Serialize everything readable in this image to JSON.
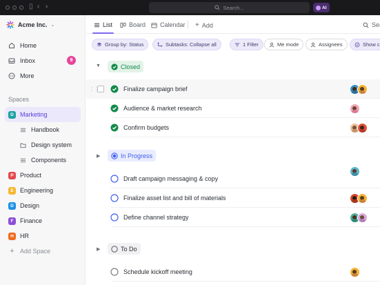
{
  "topbar": {
    "search_placeholder": "Search...",
    "ai_label": "AI"
  },
  "sidebar": {
    "workspace_name": "Acme Inc.",
    "nav": [
      {
        "label": "Home",
        "icon": "home-icon"
      },
      {
        "label": "Inbox",
        "icon": "inbox-icon",
        "badge": "9"
      },
      {
        "label": "More",
        "icon": "more-icon"
      }
    ],
    "spaces_label": "Spaces",
    "spaces": [
      {
        "letter": "D",
        "label": "Marketing",
        "color": "#1ba2a0",
        "active": true
      },
      {
        "letter": "P",
        "label": "Product",
        "color": "#e5484d"
      },
      {
        "letter": "E",
        "label": "Engineering",
        "color": "#f5b731"
      },
      {
        "letter": "D",
        "label": "Design",
        "color": "#1e90e6"
      },
      {
        "letter": "F",
        "label": "Finance",
        "color": "#8b4fd9"
      },
      {
        "letter": "H",
        "label": "HR",
        "color": "#f06a1e"
      }
    ],
    "marketing_children": [
      {
        "label": "Handbook",
        "icon": "list-icon"
      },
      {
        "label": "Design system",
        "icon": "folder-icon"
      },
      {
        "label": "Components",
        "icon": "list-icon"
      }
    ],
    "add_space_label": "Add Space"
  },
  "viewbar": {
    "tabs": [
      {
        "label": "List",
        "icon": "list-view-icon",
        "active": true
      },
      {
        "label": "Board",
        "icon": "board-icon"
      },
      {
        "label": "Calendar",
        "icon": "calendar-icon"
      },
      {
        "label": "Add",
        "icon": "plus-icon"
      }
    ],
    "search_label": "Sea"
  },
  "filters": [
    {
      "label": "Group by: Status",
      "icon": "layers-icon",
      "style": "purple"
    },
    {
      "label": "Subtasks: Collapse all",
      "icon": "subtask-icon",
      "style": "purple"
    },
    {
      "label": "1 Filter",
      "icon": "filter-icon",
      "style": "purple"
    },
    {
      "label": "Me mode",
      "icon": "user-icon",
      "style": "plain"
    },
    {
      "label": "Assignees",
      "icon": "user-icon",
      "style": "plain"
    },
    {
      "label": "Show c",
      "icon": "check-circle-icon",
      "style": "purple"
    }
  ],
  "groups": [
    {
      "status": "Closed",
      "color": "#138a4a",
      "expanded": true,
      "tasks": [
        {
          "name": "Finalize campaign brief",
          "assignees": 2
        },
        {
          "name": "Audience & market research",
          "assignees": 1
        },
        {
          "name": "Confirm budgets",
          "assignees": 2
        }
      ]
    },
    {
      "status": "In Progress",
      "color": "#3f5ff2",
      "expanded": false,
      "tasks": [
        {
          "name": "Draft campaign messaging & copy",
          "assignees": 1
        },
        {
          "name": "Finalize asset list and bill of materials",
          "assignees": 2
        },
        {
          "name": "Define channel strategy",
          "assignees": 2
        }
      ]
    },
    {
      "status": "To Do",
      "color": "#5f6369",
      "expanded": false,
      "tasks": [
        {
          "name": "Schedule kickoff meeting",
          "assignees": 1
        }
      ]
    }
  ],
  "colors": {
    "accent": "#7b68ee",
    "closed_green": "#138a4a",
    "progress_blue": "#3f5ff2",
    "badge_pink": "#e8459a"
  }
}
